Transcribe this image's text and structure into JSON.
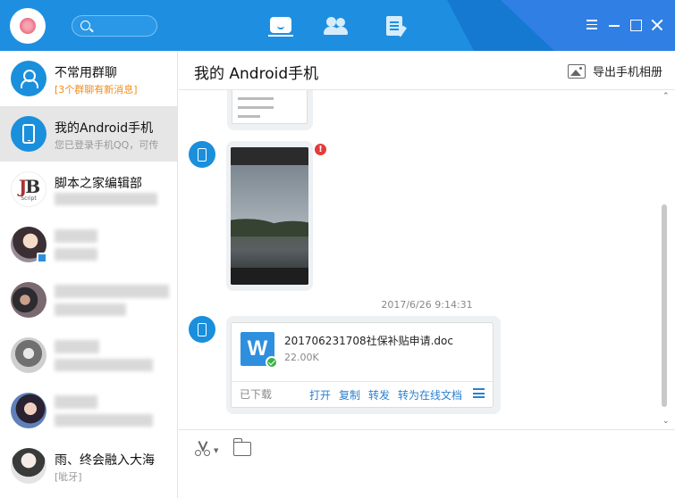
{
  "header": {
    "tabs": [
      "messages",
      "contacts",
      "space"
    ]
  },
  "sidebar": {
    "items": [
      {
        "name": "不常用群聊",
        "sub": "[3个群聊有新消息]"
      },
      {
        "name": "我的Android手机",
        "sub": "您已登录手机QQ，可传"
      },
      {
        "name": "脚本之家编辑部",
        "sub": ""
      },
      {
        "name": "",
        "sub": ""
      },
      {
        "name": "",
        "sub": ""
      },
      {
        "name": "",
        "sub": ""
      },
      {
        "name": "",
        "sub": ""
      },
      {
        "name": "雨、终会融入大海",
        "sub": "[呲牙]"
      }
    ]
  },
  "chat": {
    "title": "我的 Android手机",
    "export_label": "导出手机相册",
    "timestamp": "2017/6/26 9:14:31",
    "error_mark": "!",
    "file": {
      "name": "201706231708社保补贴申请.doc",
      "size": "22.00K",
      "icon_letter": "W",
      "status": "已下载",
      "actions": [
        "打开",
        "复制",
        "转发",
        "转为在线文档"
      ]
    }
  },
  "colors": {
    "titlebar": "#1e8fe0",
    "accent": "#2a7fd0",
    "error": "#e23b3b",
    "success": "#3fb04a",
    "pending": "#f08c1b"
  },
  "icons": {
    "search": "search-icon",
    "messages_tab": "chat-bubble-icon",
    "contacts_tab": "contacts-icon",
    "space_tab": "document-icon",
    "menu": "menu-icon",
    "minimize": "minimize-icon",
    "maximize": "maximize-icon",
    "close": "close-icon",
    "export": "image-icon",
    "cut": "scissors-icon",
    "folder": "folder-icon"
  }
}
